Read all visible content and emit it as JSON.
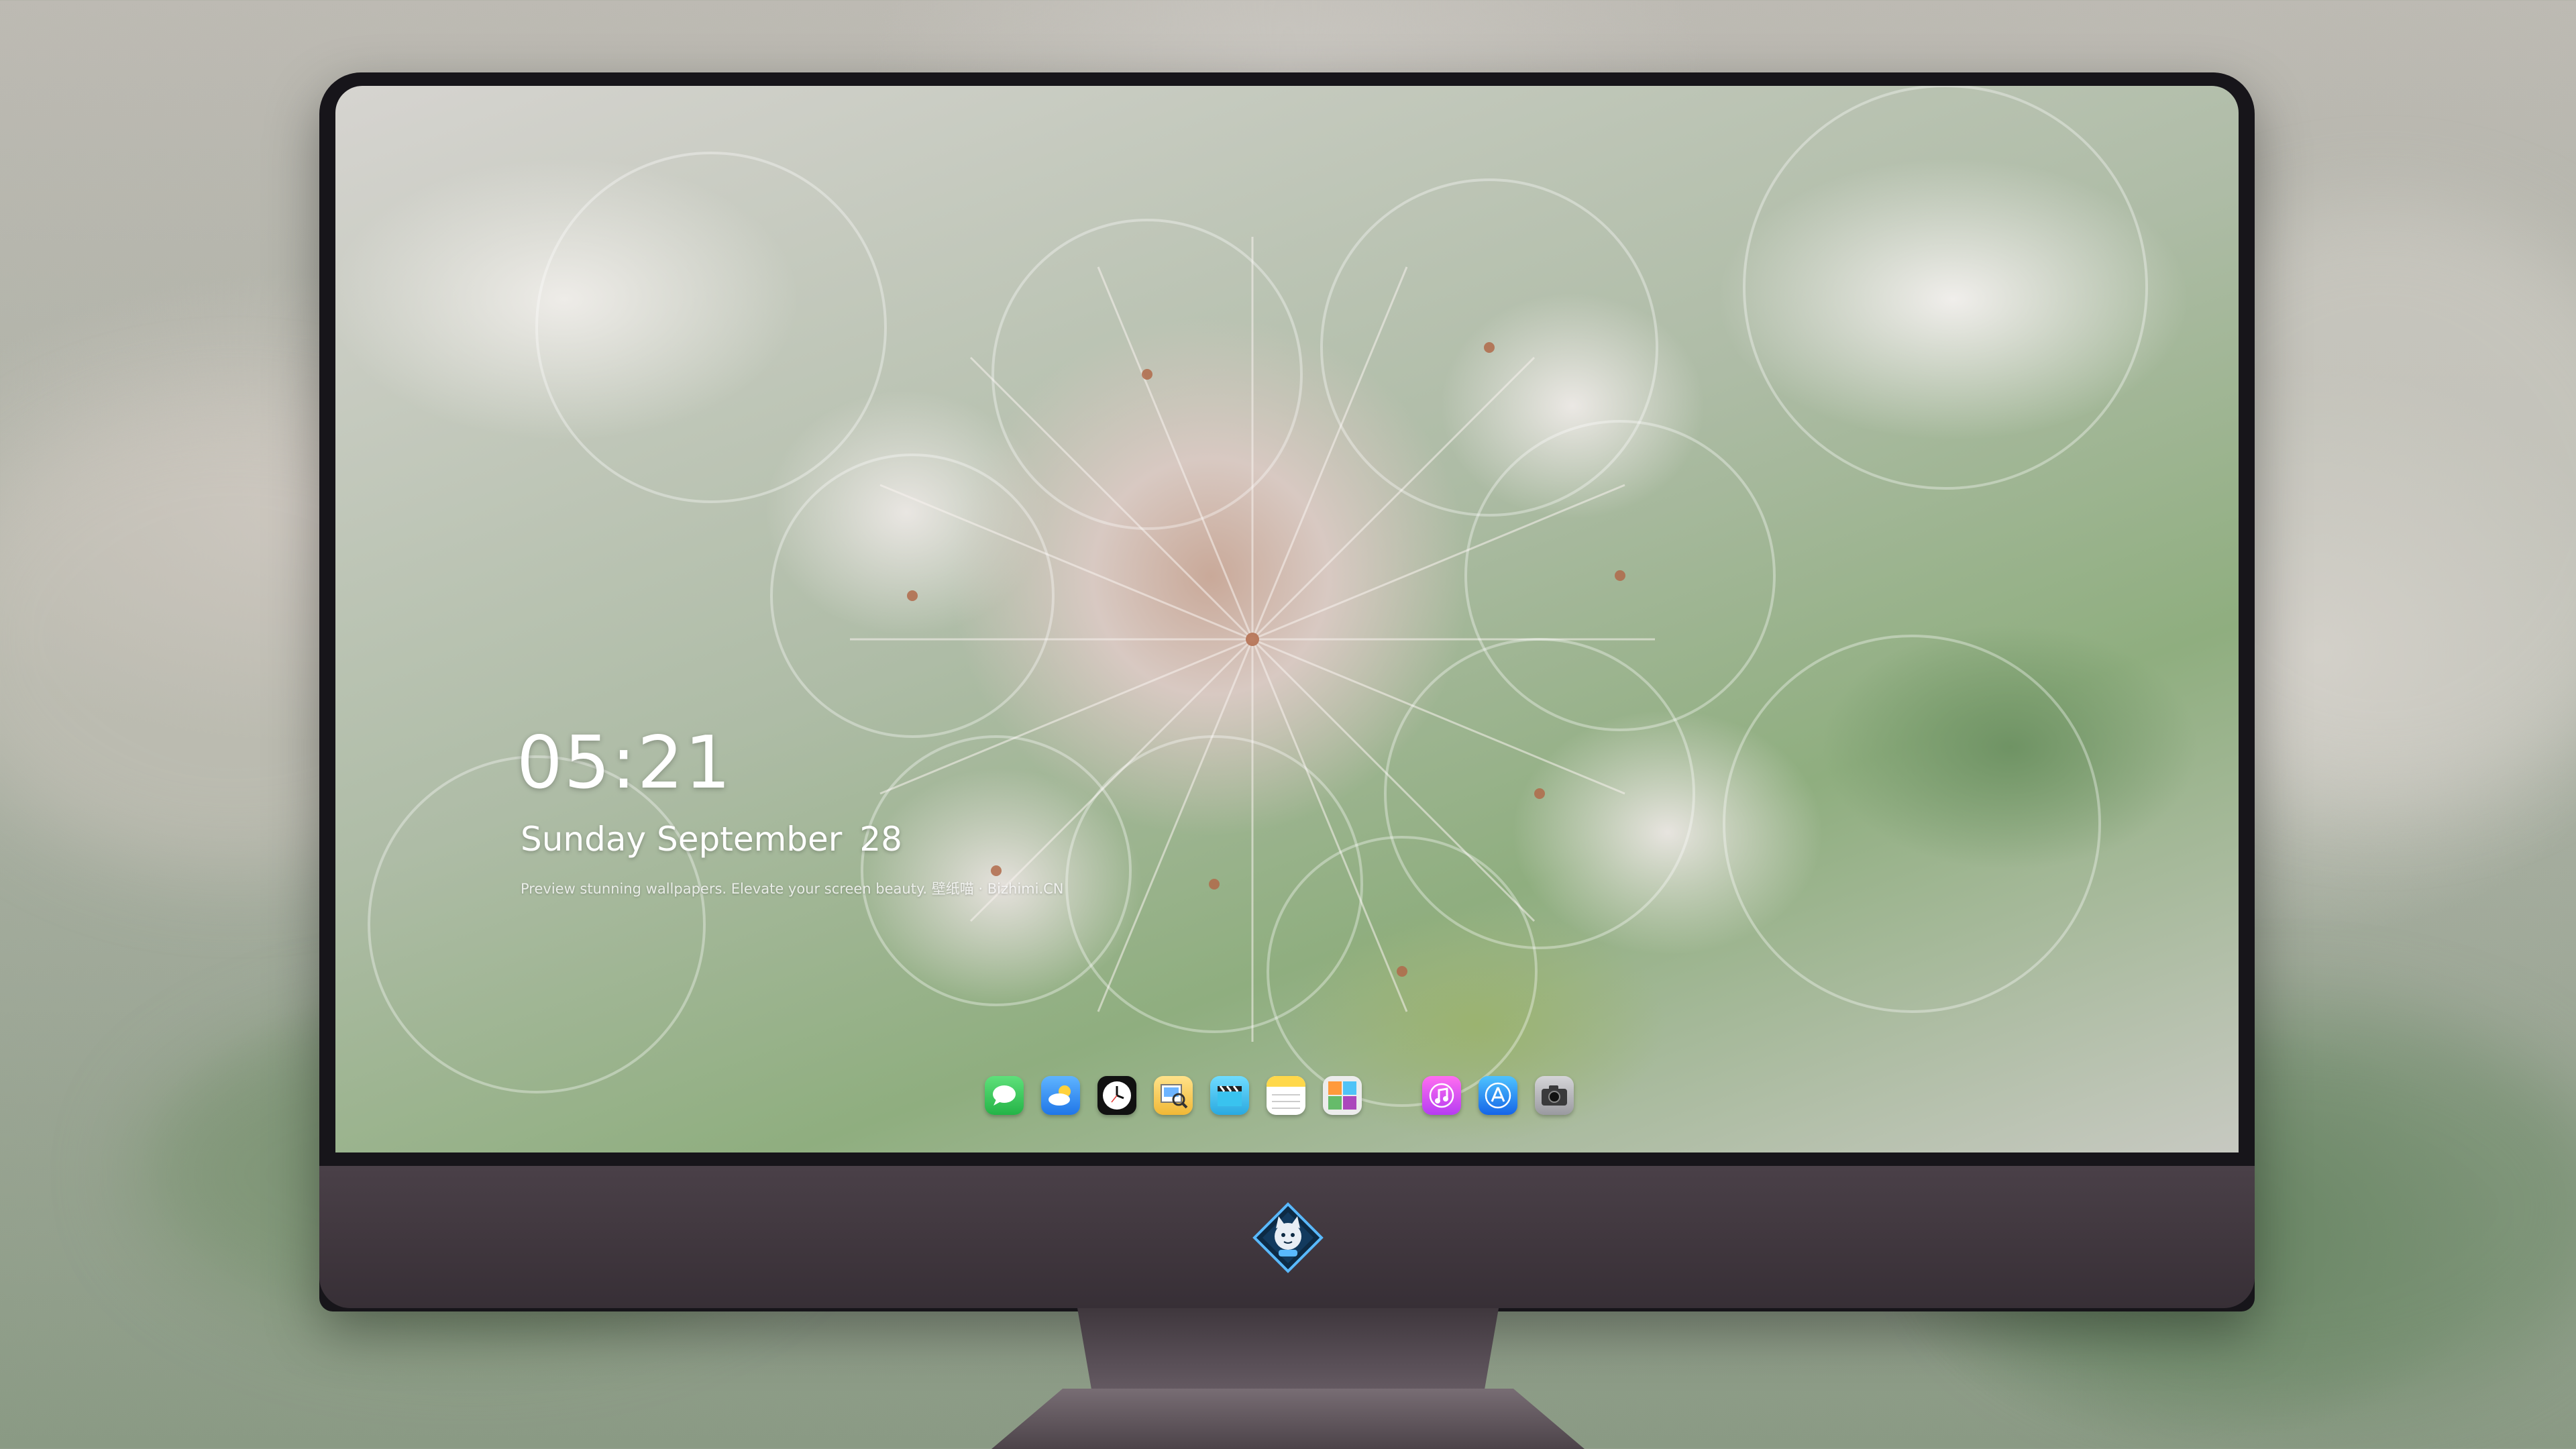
{
  "lock_screen": {
    "time": "05:21",
    "date": {
      "weekday_month": "Sunday September",
      "day": "28"
    },
    "caption": "Preview stunning wallpapers. Elevate your screen beauty. 壁纸喵 · Bizhimi.CN"
  },
  "dock": {
    "apps": [
      {
        "name": "messages",
        "icon": "messages-icon",
        "color": "#34c759"
      },
      {
        "name": "weather",
        "icon": "weather-icon",
        "color": "#2f8bff"
      },
      {
        "name": "clock",
        "icon": "clock-icon",
        "color": "#111111"
      },
      {
        "name": "preview",
        "icon": "preview-icon",
        "color": "#f4c84a"
      },
      {
        "name": "clips",
        "icon": "clapperboard-icon",
        "color": "#3fc5f0"
      },
      {
        "name": "notes",
        "icon": "notes-icon",
        "color": "#ffd84a"
      },
      {
        "name": "photo-booth",
        "icon": "photo-collage-icon",
        "color": "#e9e9e9"
      },
      {
        "name": "music",
        "icon": "music-note-icon",
        "color": "#e040fb"
      },
      {
        "name": "app-store",
        "icon": "app-store-icon",
        "color": "#1e88ff"
      },
      {
        "name": "camera",
        "icon": "camera-icon",
        "color": "#8e8e93"
      }
    ]
  },
  "monitor": {
    "logo": "cat-emblem-logo"
  }
}
